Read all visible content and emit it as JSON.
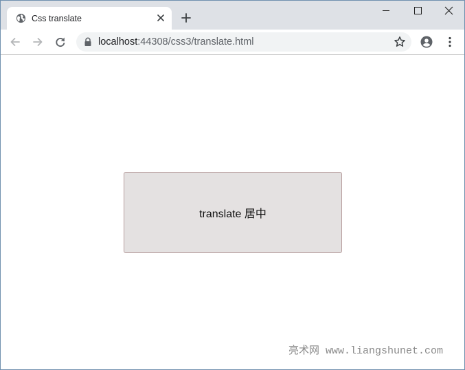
{
  "browser": {
    "tab": {
      "title": "Css translate",
      "favicon": "globe-icon",
      "close_icon": "close-icon"
    },
    "new_tab_icon": "plus-icon",
    "window_controls": [
      "minimize-icon",
      "maximize-icon",
      "close-icon"
    ],
    "toolbar": {
      "back_icon": "arrow-left-icon",
      "forward_icon": "arrow-right-icon",
      "reload_icon": "reload-icon",
      "lock_icon": "lock-icon",
      "url_host": "localhost",
      "url_rest": ":44308/css3/translate.html",
      "bookmark_icon": "star-icon",
      "profile_icon": "account-icon",
      "menu_icon": "more-vert-icon"
    }
  },
  "page": {
    "box_text": "translate 居中",
    "box_background": "#e4e1e1",
    "box_border": "#b79e9e",
    "watermark": "亮术网 www.liangshunet.com"
  }
}
